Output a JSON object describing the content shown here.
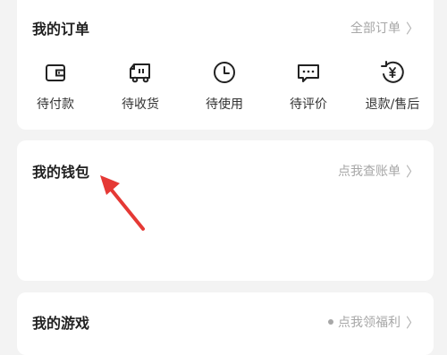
{
  "orders": {
    "title": "我的订单",
    "link_label": "全部订单",
    "items": [
      {
        "label": "待付款",
        "icon": "wallet-icon"
      },
      {
        "label": "待收货",
        "icon": "truck-icon"
      },
      {
        "label": "待使用",
        "icon": "clock-icon"
      },
      {
        "label": "待评价",
        "icon": "comment-icon"
      },
      {
        "label": "退款/售后",
        "icon": "refund-yen-icon"
      }
    ]
  },
  "wallet": {
    "title": "我的钱包",
    "link_label": "点我查账单"
  },
  "games": {
    "title": "我的游戏",
    "link_label": "点我领福利"
  },
  "colors": {
    "background": "#f3f3f3",
    "card": "#ffffff",
    "title_text": "#222222",
    "muted_text": "#a7a7a7",
    "annotation_arrow": "#e53935"
  }
}
